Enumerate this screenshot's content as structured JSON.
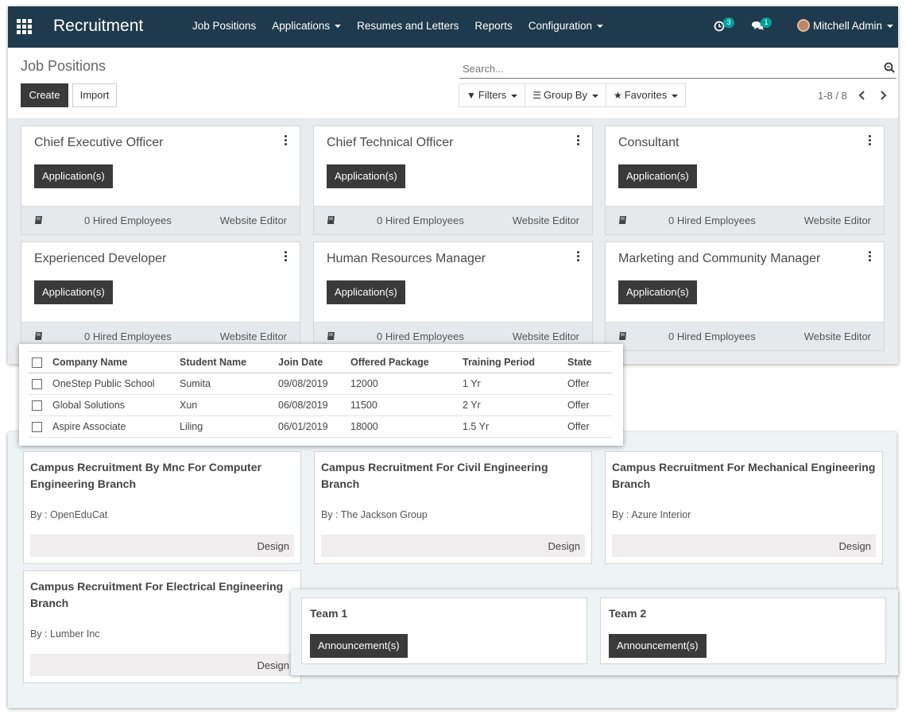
{
  "navbar": {
    "app_name": "Recruitment",
    "menu": [
      {
        "label": "Job Positions",
        "dropdown": false
      },
      {
        "label": "Applications",
        "dropdown": true
      },
      {
        "label": "Resumes and Letters",
        "dropdown": false
      },
      {
        "label": "Reports",
        "dropdown": false
      },
      {
        "label": "Configuration",
        "dropdown": true
      }
    ],
    "activity_count": "3",
    "message_count": "1",
    "user_name": "Mitchell Admin"
  },
  "control_panel": {
    "breadcrumb": "Job Positions",
    "create_label": "Create",
    "import_label": "Import",
    "search_placeholder": "Search...",
    "filters_label": "Filters",
    "group_by_label": "Group By",
    "favorites_label": "Favorites",
    "pager_text": "1-8 / 8"
  },
  "job_positions": [
    {
      "title": "Chief Executive Officer",
      "button": "Application(s)",
      "hired": "0 Hired Employees",
      "editor": "Website Editor"
    },
    {
      "title": "Chief Technical Officer",
      "button": "Application(s)",
      "hired": "0 Hired Employees",
      "editor": "Website Editor"
    },
    {
      "title": "Consultant",
      "button": "Application(s)",
      "hired": "0 Hired Employees",
      "editor": "Website Editor"
    },
    {
      "title": "Experienced Developer",
      "button": "Application(s)",
      "hired": "0 Hired Employees",
      "editor": "Website Editor"
    },
    {
      "title": "Human Resources Manager",
      "button": "Application(s)",
      "hired": "0 Hired Employees",
      "editor": "Website Editor"
    },
    {
      "title": "Marketing and Community Manager",
      "button": "Application(s)",
      "hired": "0 Hired Employees",
      "editor": "Website Editor"
    }
  ],
  "placements_table": {
    "columns": [
      "Company Name",
      "Student Name",
      "Join Date",
      "Offered Package",
      "Training Period",
      "State"
    ],
    "rows": [
      [
        "OneStep Public School",
        "Sumita",
        "09/08/2019",
        "12000",
        "1 Yr",
        "Offer"
      ],
      [
        "Global Solutions",
        "Xun",
        "06/08/2019",
        "11500",
        "2 Yr",
        "Offer"
      ],
      [
        "Aspire Associate",
        "Liling",
        "06/01/2019",
        "18000",
        "1.5 Yr",
        "Offer"
      ]
    ]
  },
  "recruitment_drives": [
    {
      "title": "Campus Recruitment By Mnc For Computer Engineering Branch",
      "by": "By : OpenEduCat",
      "stage": "Design"
    },
    {
      "title": "Campus Recruitment For Civil Engineering Branch",
      "by": "By : The Jackson Group",
      "stage": "Design"
    },
    {
      "title": "Campus Recruitment For Mechanical Engineering Branch",
      "by": "By : Azure Interior",
      "stage": "Design"
    },
    {
      "title": "Campus Recruitment For Electrical Engineering Branch",
      "by": "By : Lumber Inc",
      "stage": "Design"
    }
  ],
  "teams": [
    {
      "name": "Team 1",
      "button": "Announcement(s)"
    },
    {
      "name": "Team 2",
      "button": "Announcement(s)"
    }
  ],
  "colors": {
    "navbar_bg": "#1f3a4c",
    "primary_button": "#3a3a3a",
    "badge": "#00a09d"
  }
}
